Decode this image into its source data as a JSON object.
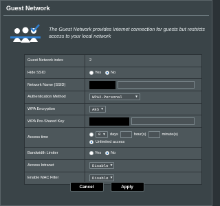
{
  "page": {
    "title": "Guest Network",
    "description": "The Guest Network provides Internet connection for guests but restricts access to your local network"
  },
  "rows": {
    "index": {
      "label": "Guest Network index",
      "value": "2"
    },
    "hide_ssid": {
      "label": "Hide SSID",
      "options": [
        "Yes",
        "No"
      ],
      "selected": "No"
    },
    "network_name": {
      "label": "Network Name (SSID)",
      "value": ""
    },
    "auth": {
      "label": "Authentication Method",
      "value": "WPA2-Personal"
    },
    "wpa_enc": {
      "label": "WPA Encryption",
      "value": "AES"
    },
    "wpa_key": {
      "label": "WPA Pre-Shared Key",
      "value": ""
    },
    "access_time": {
      "label": "Access time",
      "days_value": "0",
      "days_label": "days",
      "hours_label": "hour(s)",
      "minutes_label": "minute(s)",
      "unlimited_label": "Unlimited access",
      "selected": "Unlimited access"
    },
    "bandwidth": {
      "label": "Bandwidth Limiter",
      "options": [
        "Yes",
        "No"
      ],
      "selected": "No"
    },
    "intranet": {
      "label": "Access Intranet",
      "value": "Disable"
    },
    "mac_filter": {
      "label": "Enable MAC Filter",
      "value": "Disable"
    }
  },
  "buttons": {
    "cancel": "Cancel",
    "apply": "Apply"
  },
  "icons": {
    "hero": "guest-users-check-icon",
    "chevron": "chevron-down-icon"
  },
  "colors": {
    "panel": "#3a4448",
    "form": "#4d575b",
    "button": "#000000"
  }
}
